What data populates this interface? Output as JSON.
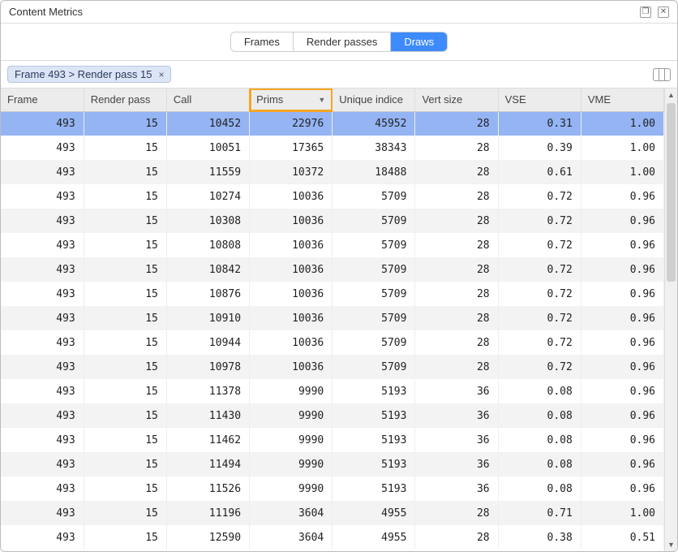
{
  "window": {
    "title": "Content Metrics"
  },
  "tabs": {
    "items": [
      "Frames",
      "Render passes",
      "Draws"
    ],
    "active_index": 2
  },
  "breadcrumb": {
    "text": "Frame 493 > Render pass 15"
  },
  "table": {
    "columns": [
      {
        "label": "Frame"
      },
      {
        "label": "Render pass"
      },
      {
        "label": "Call"
      },
      {
        "label": "Prims",
        "sorted": "desc"
      },
      {
        "label": "Unique indice"
      },
      {
        "label": "Vert size"
      },
      {
        "label": "VSE"
      },
      {
        "label": "VME"
      }
    ],
    "selected_row": 0,
    "rows": [
      [
        493,
        15,
        10452,
        22976,
        45952,
        28,
        "0.31",
        "1.00"
      ],
      [
        493,
        15,
        10051,
        17365,
        38343,
        28,
        "0.39",
        "1.00"
      ],
      [
        493,
        15,
        11559,
        10372,
        18488,
        28,
        "0.61",
        "1.00"
      ],
      [
        493,
        15,
        10274,
        10036,
        5709,
        28,
        "0.72",
        "0.96"
      ],
      [
        493,
        15,
        10308,
        10036,
        5709,
        28,
        "0.72",
        "0.96"
      ],
      [
        493,
        15,
        10808,
        10036,
        5709,
        28,
        "0.72",
        "0.96"
      ],
      [
        493,
        15,
        10842,
        10036,
        5709,
        28,
        "0.72",
        "0.96"
      ],
      [
        493,
        15,
        10876,
        10036,
        5709,
        28,
        "0.72",
        "0.96"
      ],
      [
        493,
        15,
        10910,
        10036,
        5709,
        28,
        "0.72",
        "0.96"
      ],
      [
        493,
        15,
        10944,
        10036,
        5709,
        28,
        "0.72",
        "0.96"
      ],
      [
        493,
        15,
        10978,
        10036,
        5709,
        28,
        "0.72",
        "0.96"
      ],
      [
        493,
        15,
        11378,
        9990,
        5193,
        36,
        "0.08",
        "0.96"
      ],
      [
        493,
        15,
        11430,
        9990,
        5193,
        36,
        "0.08",
        "0.96"
      ],
      [
        493,
        15,
        11462,
        9990,
        5193,
        36,
        "0.08",
        "0.96"
      ],
      [
        493,
        15,
        11494,
        9990,
        5193,
        36,
        "0.08",
        "0.96"
      ],
      [
        493,
        15,
        11526,
        9990,
        5193,
        36,
        "0.08",
        "0.96"
      ],
      [
        493,
        15,
        11196,
        3604,
        4955,
        28,
        "0.71",
        "1.00"
      ],
      [
        493,
        15,
        12590,
        3604,
        4955,
        28,
        "0.38",
        "0.51"
      ]
    ]
  }
}
